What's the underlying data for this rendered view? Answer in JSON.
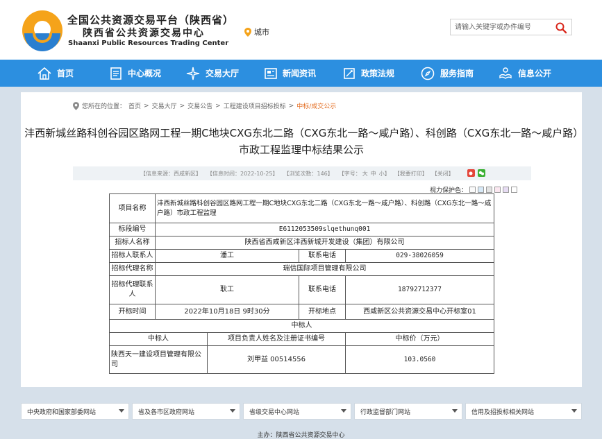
{
  "header": {
    "org_cn_line1": "全国公共资源交易平台（陕西省）",
    "org_cn_line2": "陕西省公共资源交易中心",
    "org_en": "Shaanxi Public Resources Trading Center",
    "city_label": "城市",
    "search_placeholder": "请输入关键字或办件编号"
  },
  "nav": {
    "items": [
      {
        "label": "首页",
        "icon": "home-icon"
      },
      {
        "label": "中心概况",
        "icon": "document-icon"
      },
      {
        "label": "交易大厅",
        "icon": "star-burst-icon"
      },
      {
        "label": "新闻资讯",
        "icon": "news-icon"
      },
      {
        "label": "政策法规",
        "icon": "law-book-icon"
      },
      {
        "label": "服务指南",
        "icon": "compass-icon"
      },
      {
        "label": "信息公开",
        "icon": "hand-info-icon"
      }
    ]
  },
  "breadcrumb": {
    "prefix": "您所在的位置：",
    "items": [
      "首页",
      "交易大厅",
      "交易公告",
      "工程建设项目招标投标",
      "中标/成交公示"
    ]
  },
  "article": {
    "title": "沣西新城丝路科创谷园区路网工程一期C地块CXG东北二路（CXG东北一路～咸户路）、科创路（CXG东北一路～咸户路）市政工程监理中标结果公示",
    "info_source": "【信息来源：西咸新区】",
    "info_time": "【信息时间：2022-10-25】",
    "info_views": "【浏览次数：146】",
    "font_size_label": "【字号：",
    "font_big": "大",
    "font_mid": "中",
    "font_small": "小",
    "font_close": "】",
    "print": "【我要打印】",
    "close": "【关闭】",
    "eye_protection": "视力保护色："
  },
  "table": {
    "project_name_label": "项目名称",
    "project_name": "沣西新城丝路科创谷园区路网工程一期C地块CXG东北二路（CXG东北一路～咸户路）、科创路（CXG东北一路～咸户路）市政工程监理",
    "section_no_label": "标段编号",
    "section_no": "E6112053509slqethunq001",
    "tenderer_label": "招标人名称",
    "tenderer": "陕西省西咸新区沣西新城开发建设（集团）有限公司",
    "tenderer_contact_label": "招标人联系人",
    "tenderer_contact": "潘工",
    "phone_label": "联系电话",
    "tenderer_phone": "029-38026059",
    "agency_label": "招标代理名称",
    "agency": "瑞信国际项目管理有限公司",
    "agency_contact_label": "招标代理联系人",
    "agency_contact": "耿工",
    "agency_phone": "18792712377",
    "open_time_label": "开标时间",
    "open_time": "2022年10月18日 9时30分",
    "open_place_label": "开标地点",
    "open_place": "西咸新区公共资源交易中心开标室01",
    "winner_section": "中标人",
    "col_winner": "中标人",
    "col_pm": "项目负责人姓名及注册证书编号",
    "col_price": "中标价（万元）",
    "winner_name": "陕西天一建设项目管理有限公司",
    "winner_pm": "刘甲益  00514556",
    "winner_price": "103.0560"
  },
  "footer": {
    "links": [
      "中央政府和国家部委网站",
      "省及各市区政府网站",
      "省级交易中心网站",
      "行政监督部门网站",
      "信用及招投标相关网站"
    ],
    "sponsor": "主办：陕西省公共资源交易中心"
  },
  "colors": {
    "nav_blue": "#2c8fe0",
    "logo_orange": "#f5a31a",
    "logo_blue": "#2a7fd0",
    "breadcrumb_current": "#e36b1e",
    "page_bg": "#d6e0ea"
  }
}
